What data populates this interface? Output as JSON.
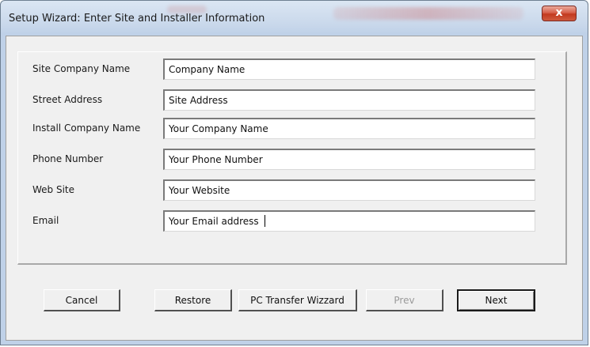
{
  "window": {
    "title": "Setup Wizard: Enter Site and Installer Information",
    "close_symbol": "x",
    "close_icon": "close-icon"
  },
  "fields": [
    {
      "label": "Site Company Name",
      "value": "Company Name"
    },
    {
      "label": "Street Address",
      "value": "Site Address"
    },
    {
      "label": "Install Company Name",
      "value": "Your Company Name"
    },
    {
      "label": "Phone Number",
      "value": "Your Phone Number"
    },
    {
      "label": "Web Site",
      "value": "Your Website"
    },
    {
      "label": "Email",
      "value": "Your Email address"
    }
  ],
  "buttons": {
    "cancel": "Cancel",
    "restore": "Restore",
    "pc_transfer": "PC Transfer Wizzard",
    "prev": "Prev",
    "next": "Next"
  },
  "colors": {
    "close_button": "#c2391f",
    "dialog_background": "#f0f0f0"
  }
}
